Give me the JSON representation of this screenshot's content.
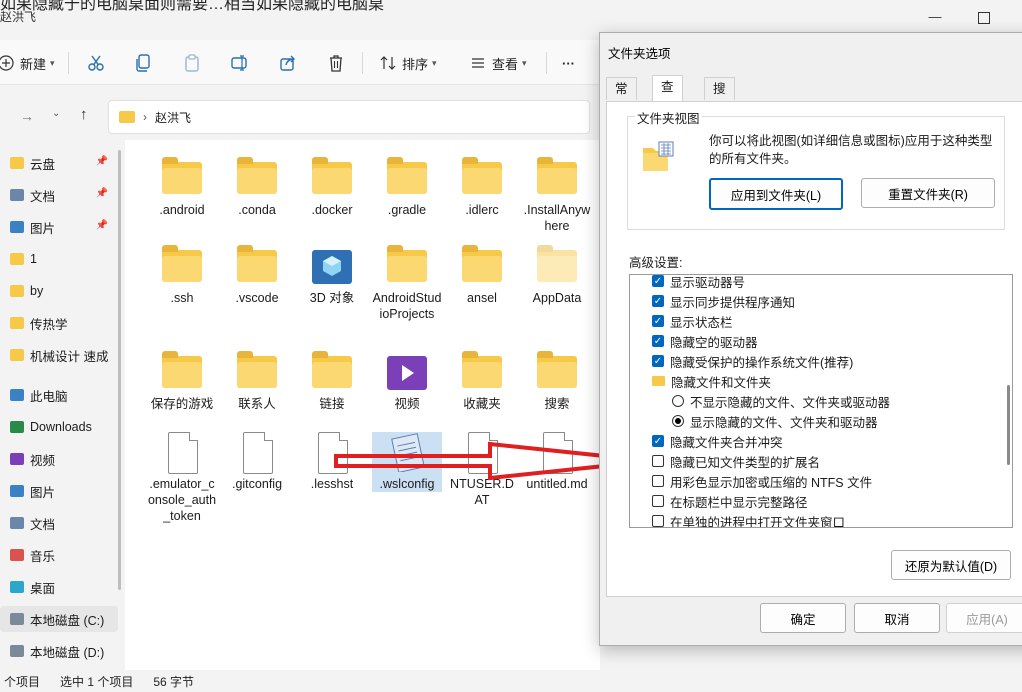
{
  "explorer": {
    "top_cut_text": "如果隐藏于的电脑桌面则需要…相当如果隐藏的电脑桌",
    "title": "赵洪飞",
    "toolbar": {
      "new_label": "新建",
      "sort_label": "排序",
      "view_label": "查看",
      "more_label": "···"
    },
    "address": {
      "path": "赵洪飞"
    },
    "nav": {
      "items": [
        {
          "label": "云盘",
          "icon": "folder-icon",
          "pinned": true
        },
        {
          "label": "文档",
          "icon": "documents-icon",
          "pinned": true
        },
        {
          "label": "图片",
          "icon": "pictures-icon",
          "pinned": true
        },
        {
          "label": "1",
          "icon": "folder-icon"
        },
        {
          "label": "by",
          "icon": "folder-icon"
        },
        {
          "label": "传热学",
          "icon": "folder-icon"
        },
        {
          "label": "机械设计 速成",
          "icon": "folder-icon"
        },
        {
          "label": "此电脑",
          "icon": "pc-icon"
        },
        {
          "label": "Downloads",
          "icon": "download-icon"
        },
        {
          "label": "视频",
          "icon": "video-icon"
        },
        {
          "label": "图片",
          "icon": "pictures-icon"
        },
        {
          "label": "文档",
          "icon": "documents-icon"
        },
        {
          "label": "音乐",
          "icon": "music-icon"
        },
        {
          "label": "桌面",
          "icon": "desktop-icon"
        },
        {
          "label": "本地磁盘 (C:)",
          "icon": "drive-icon",
          "selected": true
        },
        {
          "label": "本地磁盘 (D:)",
          "icon": "drive-icon"
        }
      ]
    },
    "files": [
      {
        "name": ".android",
        "type": "folder"
      },
      {
        "name": ".conda",
        "type": "folder"
      },
      {
        "name": ".docker",
        "type": "folder"
      },
      {
        "name": ".gradle",
        "type": "folder"
      },
      {
        "name": ".idlerc",
        "type": "folder"
      },
      {
        "name": ".InstallAnywhere",
        "type": "folder"
      },
      {
        "name": ".ssh",
        "type": "folder"
      },
      {
        "name": ".vscode",
        "type": "folder"
      },
      {
        "name": "3D 对象",
        "type": "3d"
      },
      {
        "name": "AndroidStudioProjects",
        "type": "folder"
      },
      {
        "name": "ansel",
        "type": "folder"
      },
      {
        "name": "AppData",
        "type": "folder-faded"
      },
      {
        "name": "保存的游戏",
        "type": "folder"
      },
      {
        "name": "联系人",
        "type": "folder"
      },
      {
        "name": "链接",
        "type": "folder"
      },
      {
        "name": "视频",
        "type": "video"
      },
      {
        "name": "收藏夹",
        "type": "folder"
      },
      {
        "name": "搜索",
        "type": "folder"
      },
      {
        "name": ".emulator_console_auth_token",
        "type": "file"
      },
      {
        "name": ".gitconfig",
        "type": "file"
      },
      {
        "name": ".lesshst",
        "type": "file"
      },
      {
        "name": ".wslconfig",
        "type": "notepad",
        "selected": true
      },
      {
        "name": "NTUSER.DAT",
        "type": "file"
      },
      {
        "name": "untitled.md",
        "type": "file"
      }
    ],
    "status": {
      "count": "个项目",
      "selected": "选中 1 个项目",
      "size": "56 字节"
    }
  },
  "dialog": {
    "title": "文件夹选项",
    "tabs": [
      {
        "label": "常规"
      },
      {
        "label": "查看",
        "active": true
      },
      {
        "label": "搜索"
      }
    ],
    "folder_view": {
      "group_label": "文件夹视图",
      "description": "你可以将此视图(如详细信息或图标)应用于这种类型的所有文件夹。",
      "apply_button": "应用到文件夹(L)",
      "reset_button": "重置文件夹(R)"
    },
    "advanced_label": "高级设置:",
    "advanced_items": [
      {
        "kind": "checkbox",
        "checked": true,
        "label": "显示驱动器号",
        "indent": 0
      },
      {
        "kind": "checkbox",
        "checked": true,
        "label": "显示同步提供程序通知",
        "indent": 0
      },
      {
        "kind": "checkbox",
        "checked": true,
        "label": "显示状态栏",
        "indent": 0
      },
      {
        "kind": "checkbox",
        "checked": true,
        "label": "隐藏空的驱动器",
        "indent": 0
      },
      {
        "kind": "checkbox",
        "checked": true,
        "label": "隐藏受保护的操作系统文件(推荐)",
        "indent": 0
      },
      {
        "kind": "folder",
        "label": "隐藏文件和文件夹",
        "indent": 0
      },
      {
        "kind": "radio",
        "checked": false,
        "label": "不显示隐藏的文件、文件夹或驱动器",
        "indent": 1
      },
      {
        "kind": "radio",
        "checked": true,
        "label": "显示隐藏的文件、文件夹和驱动器",
        "indent": 1
      },
      {
        "kind": "checkbox",
        "checked": true,
        "label": "隐藏文件夹合并冲突",
        "indent": 0
      },
      {
        "kind": "checkbox",
        "checked": false,
        "label": "隐藏已知文件类型的扩展名",
        "indent": 0
      },
      {
        "kind": "checkbox",
        "checked": false,
        "label": "用彩色显示加密或压缩的 NTFS 文件",
        "indent": 0
      },
      {
        "kind": "checkbox",
        "checked": false,
        "label": "在标题栏中显示完整路径",
        "indent": 0
      },
      {
        "kind": "checkbox",
        "checked": false,
        "label": "在单独的进程中打开文件夹窗口",
        "indent": 0
      }
    ],
    "restore_defaults": "还原为默认值(D)",
    "ok": "确定",
    "cancel": "取消",
    "apply": "应用(A)"
  },
  "colors": {
    "accent": "#0067c0",
    "folder": "#f7c948",
    "annotation_arrow": "#e02020"
  }
}
